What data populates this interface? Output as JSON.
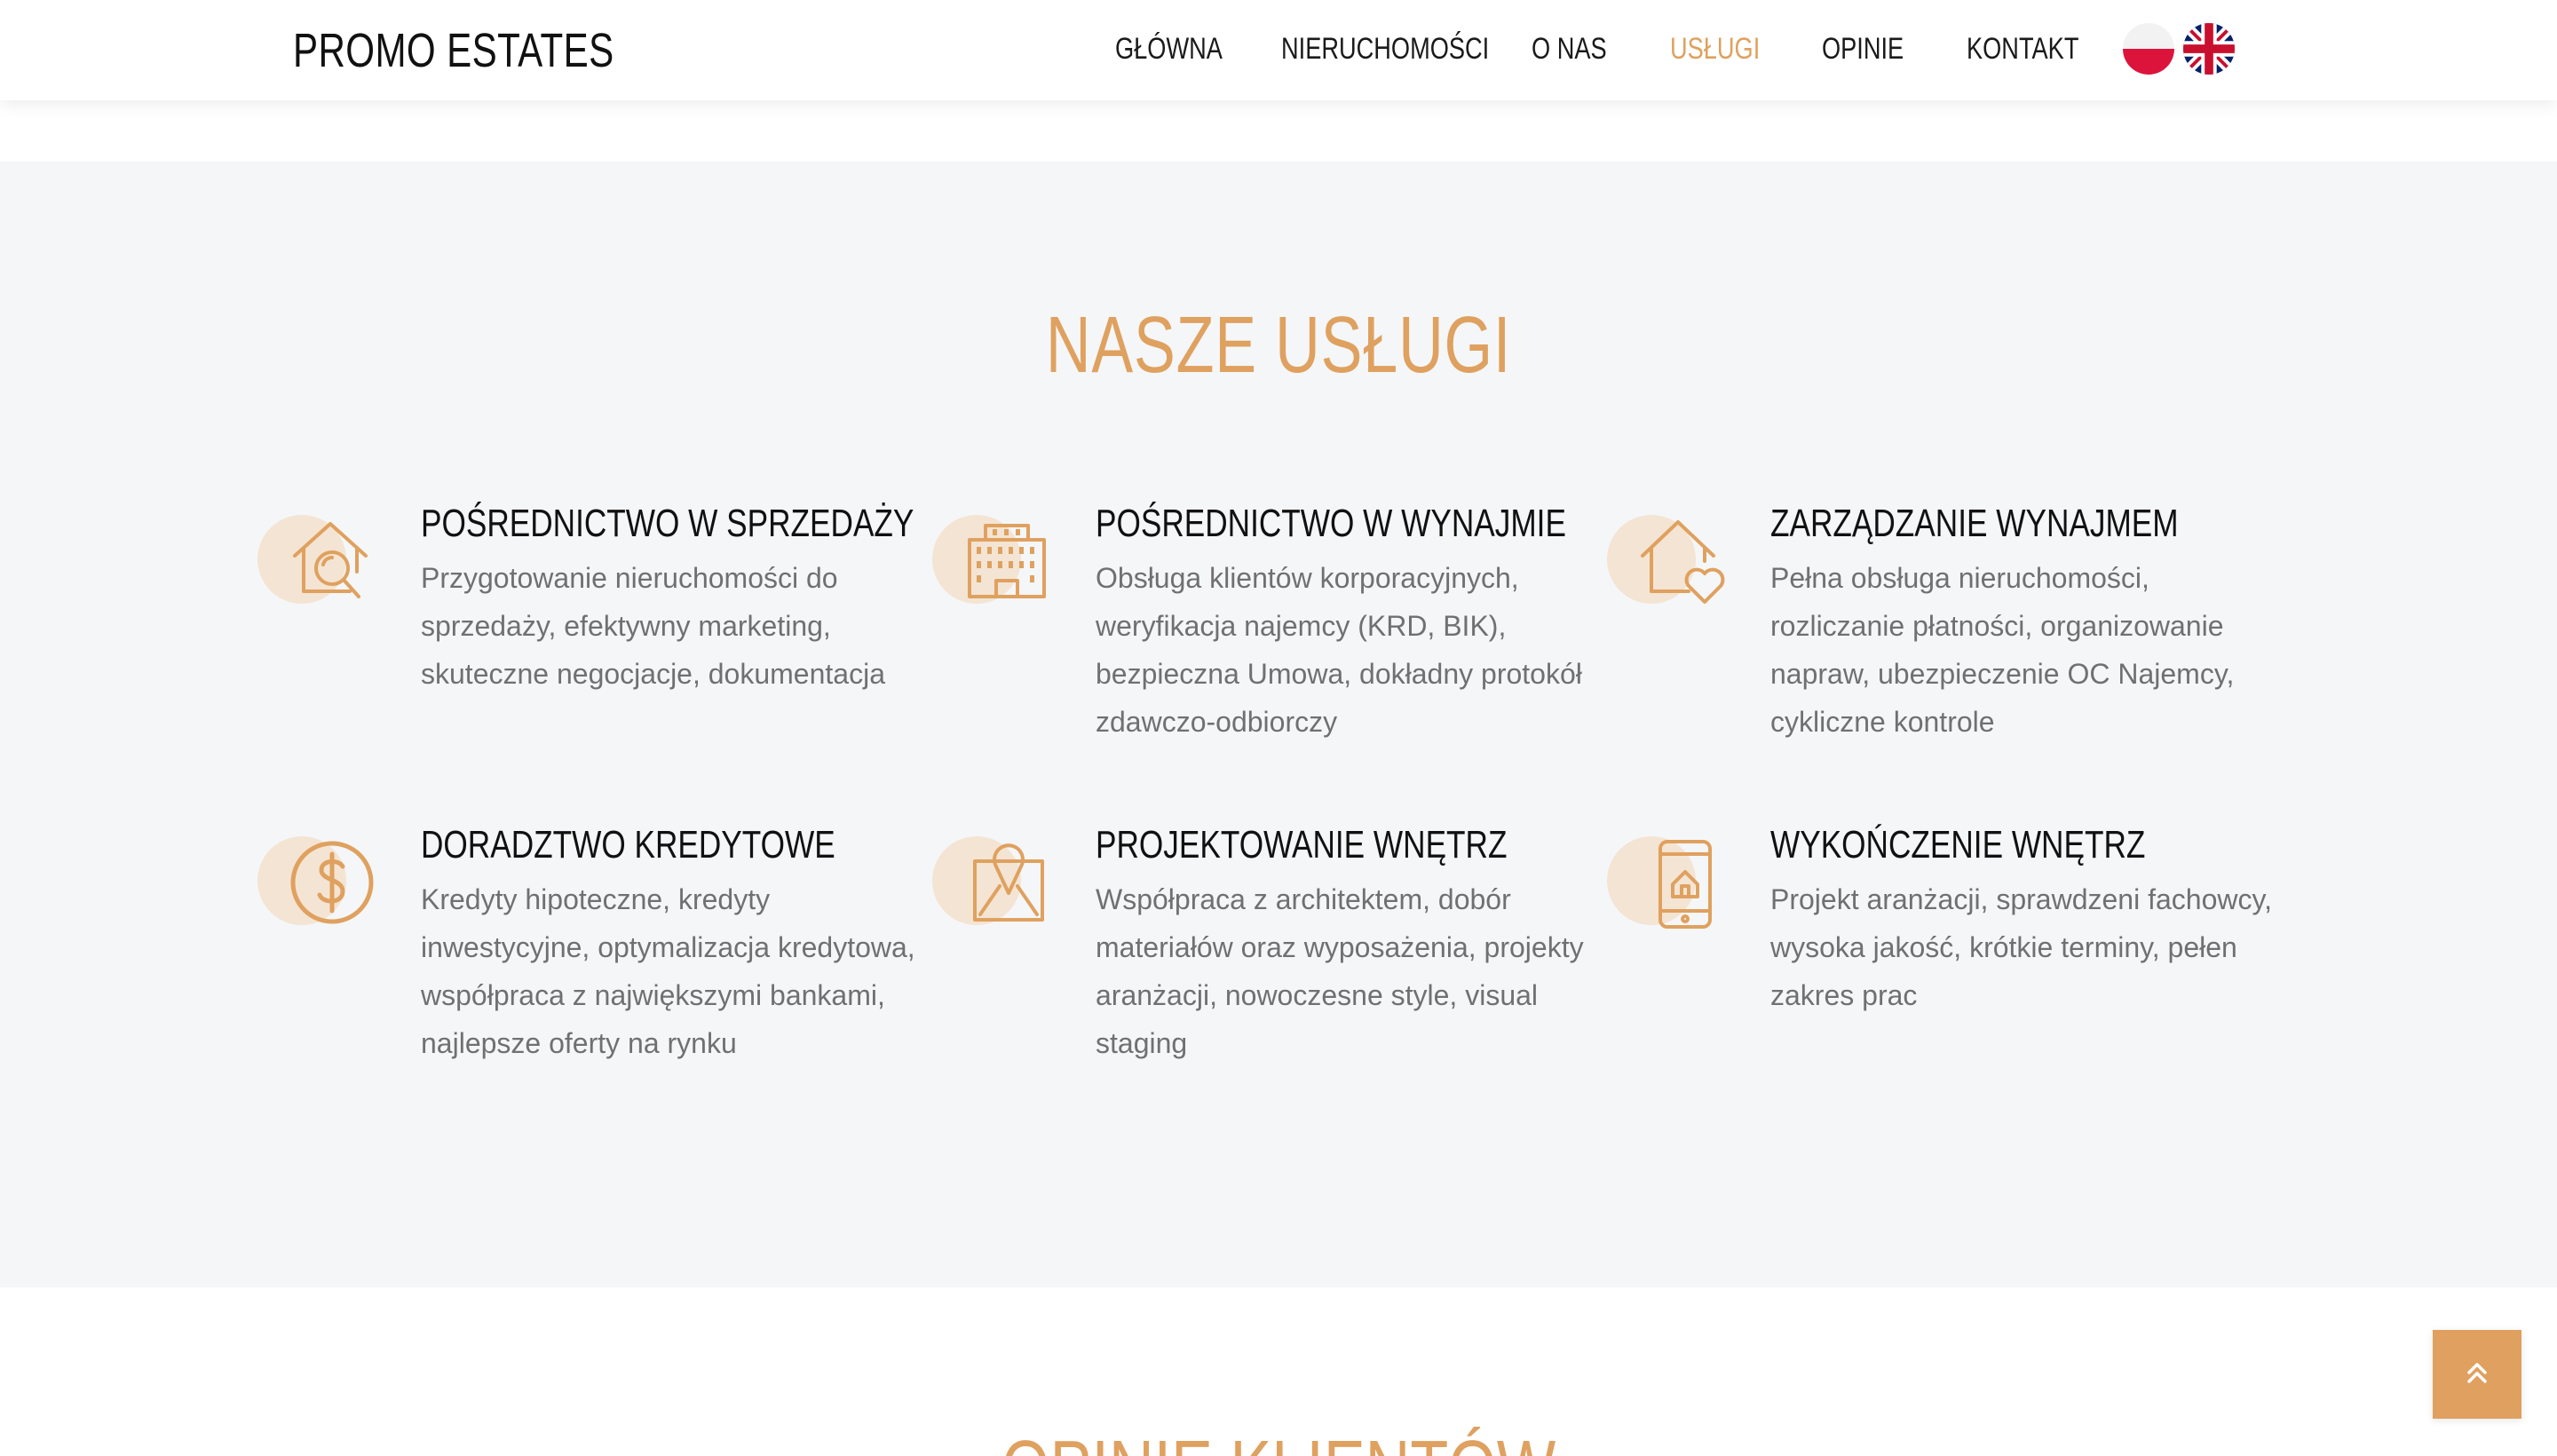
{
  "header": {
    "logo": "PROMO ESTATES",
    "nav": [
      {
        "label": "GŁÓWNA",
        "active": false
      },
      {
        "label": "NIERUCHOMOŚCI",
        "active": false
      },
      {
        "label": "O NAS",
        "active": false
      },
      {
        "label": "USŁUGI",
        "active": true
      },
      {
        "label": "OPINIE",
        "active": false
      },
      {
        "label": "KONTAKT",
        "active": false
      }
    ],
    "languages": [
      {
        "flag": "poland-flag-icon"
      },
      {
        "flag": "uk-flag-icon"
      }
    ]
  },
  "services": {
    "title": "NASZE USŁUGI",
    "items": [
      {
        "icon": "house-search-icon",
        "title": "POŚREDNICTWO W SPRZEDAŻY",
        "description": "Przygotowanie nieruchomości do sprzedaży, efektywny marketing, skuteczne negocjacje, dokumentacja"
      },
      {
        "icon": "office-building-icon",
        "title": "POŚREDNICTWO W WYNAJMIE",
        "description": "Obsługa klientów korporacyjnych, weryfikacja najemcy (KRD, BIK), bezpieczna Umowa, dokładny protokół zdawczo-odbiorczy"
      },
      {
        "icon": "house-heart-icon",
        "title": "ZARZĄDZANIE WYNAJMEM",
        "description": "Pełna obsługa nieruchomości, rozliczanie płatności, organizowanie napraw, ubezpieczenie OC Najemcy, cykliczne kontrole"
      },
      {
        "icon": "dollar-coin-icon",
        "title": "DORADZTWO KREDYTOWE",
        "description": "Kredyty hipoteczne, kredyty inwestycyjne, optymalizacja kredytowa, współpraca z największymi bankami, najlepsze oferty na rynku"
      },
      {
        "icon": "map-pin-icon",
        "title": "PROJEKTOWANIE WNĘTRZ",
        "description": "Współpraca z architektem, dobór materiałów oraz wyposażenia, projekty aranżacji, nowoczesne style, visual staging"
      },
      {
        "icon": "smartphone-house-icon",
        "title": "WYKOŃCZENIE WNĘTRZ",
        "description": "Projekt aranżacji, sprawdzeni fachowcy, wysoka jakość, krótkie terminy, pełen zakres prac"
      }
    ]
  },
  "opinions": {
    "title": "OPINIE KLIENTÓW"
  },
  "scroll_top": {
    "icon": "double-chevron-up-icon"
  },
  "colors": {
    "accent": "#dfa15f",
    "icon_bg": "#f4e4d3",
    "section_bg": "#f5f6f8",
    "text_dark": "#111111",
    "text_muted": "#707070"
  }
}
